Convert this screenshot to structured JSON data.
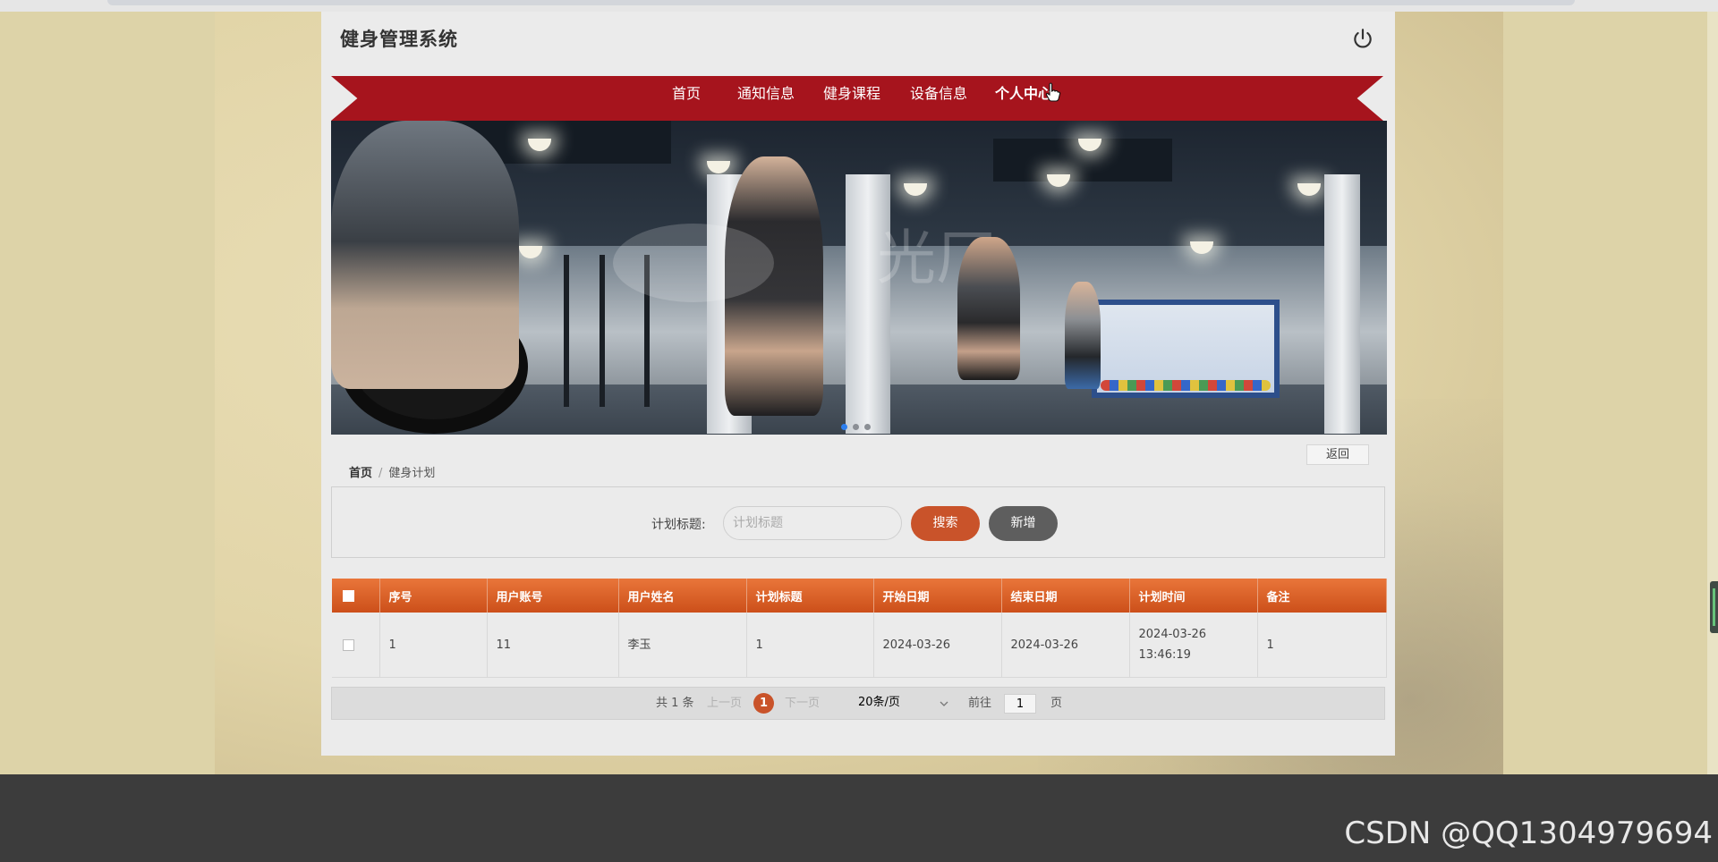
{
  "app": {
    "brand": "健身管理系统"
  },
  "nav": {
    "items": [
      "首页",
      "通知信息",
      "健身课程",
      "设备信息",
      "个人中心"
    ],
    "active_index": 4
  },
  "banner": {
    "watermark_text": "光厂",
    "active_slide": 1,
    "slide_count": 3
  },
  "back_label": "返回",
  "breadcrumb": {
    "home": "首页",
    "sep": "/",
    "current": "健身计划"
  },
  "search": {
    "label": "计划标题:",
    "placeholder": "计划标题",
    "search_btn": "搜索",
    "add_btn": "新增"
  },
  "table": {
    "headers": [
      "序号",
      "用户账号",
      "用户姓名",
      "计划标题",
      "开始日期",
      "结束日期",
      "计划时间",
      "备注"
    ],
    "rows": [
      [
        "1",
        "11",
        "李玉",
        "1",
        "2024-03-26",
        "2024-03-26",
        "2024-03-26 13:46:19",
        "1"
      ]
    ]
  },
  "pager": {
    "total": "共 1 条",
    "prev": "上一页",
    "current": "1",
    "next": "下一页",
    "size": "20条/页",
    "goto_label": "前往",
    "goto_value": "1",
    "page_suffix": "页"
  },
  "watermark": "CSDN @QQ1304979694",
  "colors": {
    "nav_red": "#a6141d",
    "accent_orange": "#c9532a",
    "header_orange": "#e9763a",
    "add_gray": "#5e5e5e"
  }
}
